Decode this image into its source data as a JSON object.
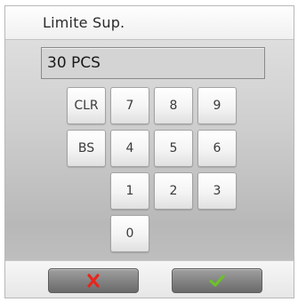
{
  "dialog": {
    "title": "Limite Sup.",
    "value": "30 PCS"
  },
  "keypad": {
    "clr": "CLR",
    "bs": "BS",
    "k0": "0",
    "k1": "1",
    "k2": "2",
    "k3": "3",
    "k4": "4",
    "k5": "5",
    "k6": "6",
    "k7": "7",
    "k8": "8",
    "k9": "9"
  },
  "actions": {
    "cancel_icon": "red-x-icon",
    "confirm_icon": "green-checkmark-icon",
    "cancel_color": "#e8261e",
    "confirm_color": "#6cc12a"
  }
}
